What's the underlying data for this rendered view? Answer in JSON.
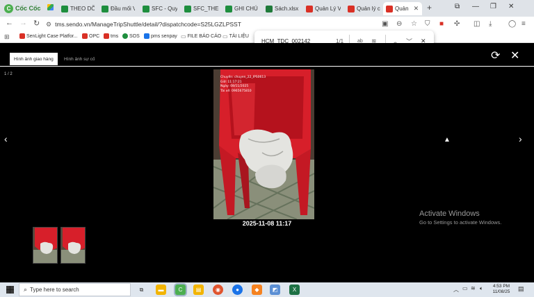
{
  "browser": {
    "brand": "Cốc Cốc",
    "tabs": [
      {
        "label": "THEO DÕI",
        "color": "#1e8e3e"
      },
      {
        "label": "Đầu mối V",
        "color": "#1e8e3e"
      },
      {
        "label": "SFC - Quy",
        "color": "#1e8e3e"
      },
      {
        "label": "SFC_THEO",
        "color": "#1e8e3e"
      },
      {
        "label": "GHI CHÚ c",
        "color": "#1e8e3e"
      },
      {
        "label": "Sách.xlsx",
        "color": "#1f7a3a"
      },
      {
        "label": "Quản Lý V",
        "color": "#d93025"
      },
      {
        "label": "Quản lý c",
        "color": "#d93025"
      },
      {
        "label": "Quản",
        "color": "#d93025"
      }
    ],
    "new_tab": "+",
    "url": "tms.sendo.vn/ManageTripShuttle/detail/?dispatchcode=S25LGZLPSST",
    "bookmarks": [
      {
        "label": "SenLight Case Platfor...",
        "color": "#d93025"
      },
      {
        "label": "OPC",
        "color": "#d93025"
      },
      {
        "label": "tms",
        "color": "#d93025"
      },
      {
        "label": "SOS",
        "color": "#1e8e3e"
      },
      {
        "label": "pms senpay",
        "color": "#1a73e8"
      },
      {
        "label": "FILE BÁO CÁO",
        "color": "#888888"
      },
      {
        "label": "TÀI LIỆU",
        "color": "#888888"
      }
    ]
  },
  "find": {
    "query": "HCM_TDC_002142",
    "count": "1/1",
    "match_case_label": "ab"
  },
  "viewer": {
    "tabs": [
      "Hình ảnh giao hàng",
      "Hình ảnh sự cố"
    ],
    "counter": "1 / 2",
    "photo_overlay": [
      "Chuyến: chuyen_22_IPS0613",
      "Giờ: 11:17:21",
      "Ngày: 08/11/2025",
      "Tài xế: 0965675810"
    ],
    "caption": "2025-11-08 11:17",
    "prev": "‹",
    "next": "›",
    "refresh": "⟳",
    "close": "✕"
  },
  "watermark": {
    "title": "Activate Windows",
    "subtitle": "Go to Settings to activate Windows."
  },
  "taskbar": {
    "search_placeholder": "Type here to search",
    "time": "4:53 PM",
    "date": "11/08/25"
  },
  "colors": {
    "accent_blue": "#1a73e8",
    "chair_red": "#d71f2a"
  }
}
